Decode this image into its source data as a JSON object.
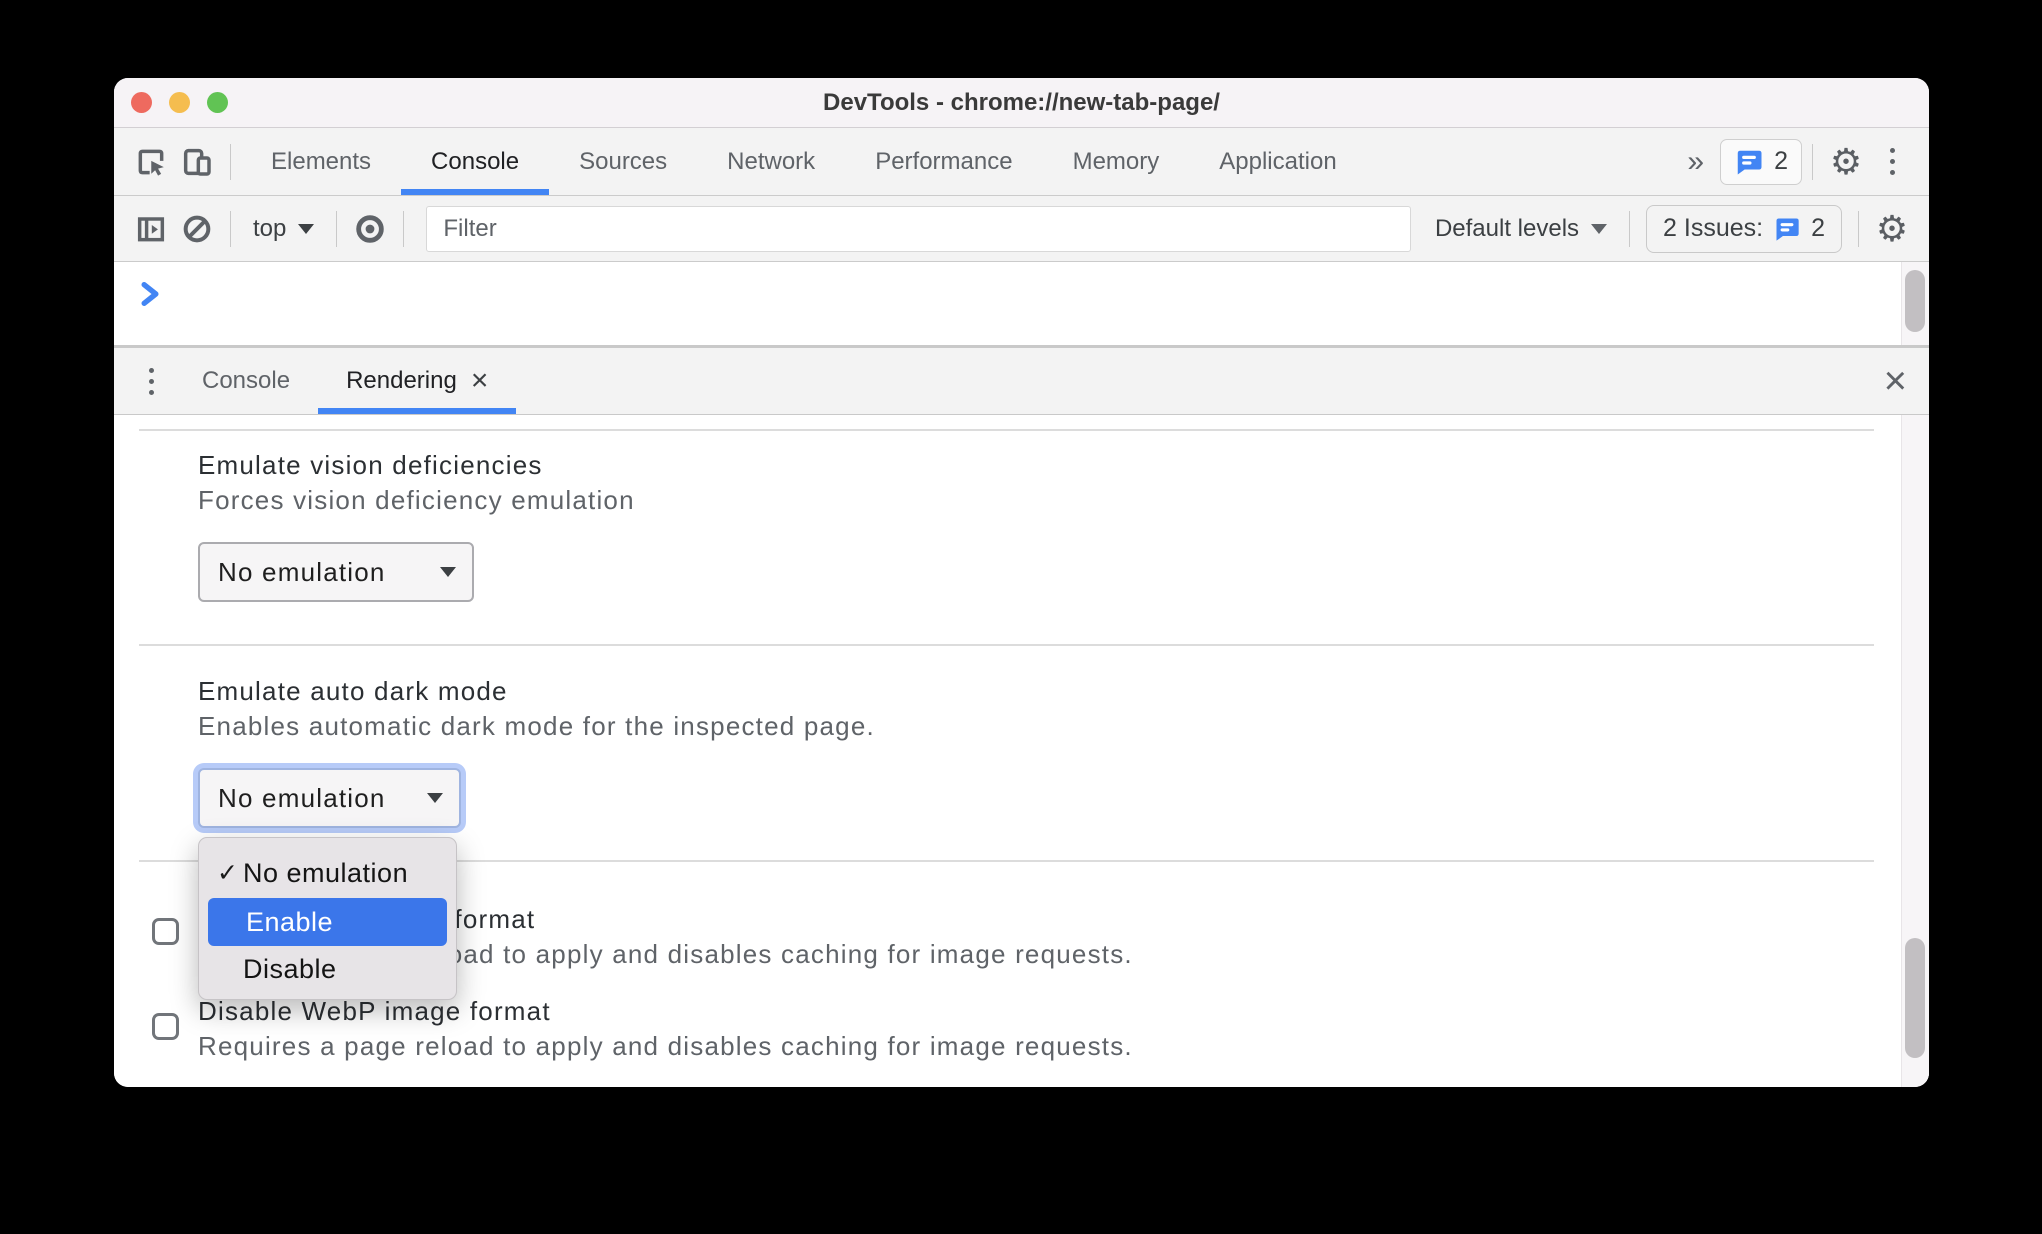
{
  "window": {
    "title": "DevTools - chrome://new-tab-page/"
  },
  "icons": {
    "settings_gear": "⚙",
    "overflow_chevrons": "»",
    "kebab_menu": "⋮",
    "close": "×",
    "checkmark": "✓",
    "prompt_symbol": ">"
  },
  "main_tabs": {
    "items": [
      {
        "label": "Elements",
        "active": false
      },
      {
        "label": "Console",
        "active": true
      },
      {
        "label": "Sources",
        "active": false
      },
      {
        "label": "Network",
        "active": false
      },
      {
        "label": "Performance",
        "active": false
      },
      {
        "label": "Memory",
        "active": false
      },
      {
        "label": "Application",
        "active": false
      }
    ],
    "messages_badge_count": "2"
  },
  "console_toolbar": {
    "context_selector": "top",
    "filter_placeholder": "Filter",
    "levels_selector": "Default levels",
    "issues_label": "2 Issues:",
    "issues_count": "2"
  },
  "drawer": {
    "tabs": [
      {
        "label": "Console",
        "active": false
      },
      {
        "label": "Rendering",
        "active": true,
        "closable": true
      }
    ]
  },
  "rendering": {
    "vision_section": {
      "title": "Emulate vision deficiencies",
      "description": "Forces vision deficiency emulation",
      "select_value": "No emulation"
    },
    "dark_mode_section": {
      "title": "Emulate auto dark mode",
      "description": "Enables automatic dark mode for the inspected page.",
      "select_value": "No emulation",
      "menu": {
        "items": [
          {
            "label": "No emulation",
            "checked": true,
            "highlighted": false
          },
          {
            "label": "Enable",
            "checked": false,
            "highlighted": true
          },
          {
            "label": "Disable",
            "checked": false,
            "highlighted": false
          }
        ]
      }
    },
    "image_format_section": {
      "rows": [
        {
          "label": "Disable AVIF image format",
          "description": "Requires a page reload to apply and disables caching for image requests.",
          "checked": false
        },
        {
          "label": "Disable WebP image format",
          "description": "Requires a page reload to apply and disables caching for image requests.",
          "checked": false
        }
      ]
    }
  },
  "colors": {
    "accent_blue": "#4285f4",
    "menu_highlight": "#3b76ea",
    "focus_ring": "#b7cbf8",
    "toolbar_bg": "#f3f3f3",
    "menu_bg": "#e7e4e7",
    "traffic_red": "#ee6a5f",
    "traffic_yellow": "#f5bd4f",
    "traffic_green": "#61c354"
  }
}
